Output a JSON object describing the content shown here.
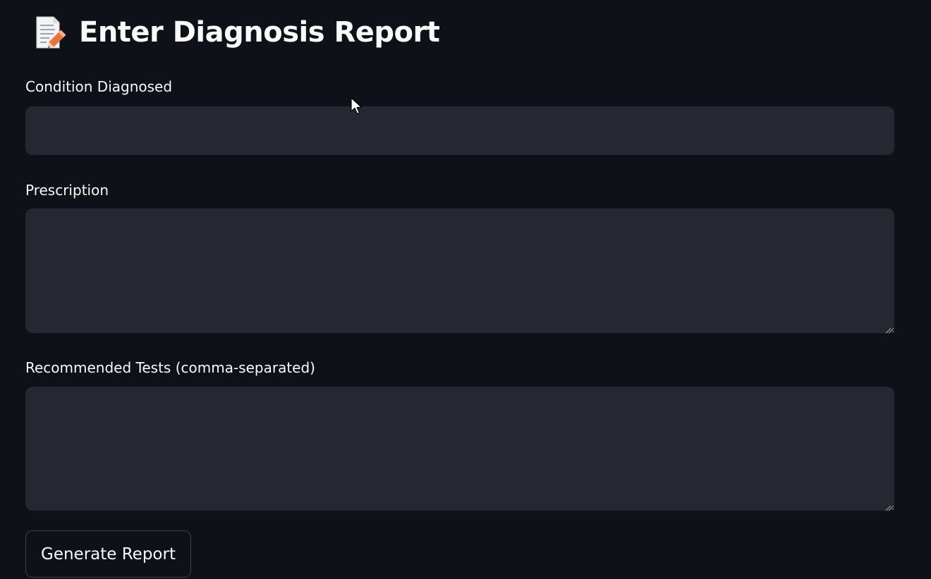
{
  "header": {
    "icon": "memo-icon",
    "title": "Enter Diagnosis Report"
  },
  "form": {
    "condition": {
      "label": "Condition Diagnosed",
      "value": "",
      "placeholder": ""
    },
    "prescription": {
      "label": "Prescription",
      "value": "",
      "placeholder": ""
    },
    "tests": {
      "label": "Recommended Tests (comma-separated)",
      "value": "",
      "placeholder": ""
    },
    "submit_label": "Generate Report"
  },
  "colors": {
    "background": "#0e1117",
    "input_background": "#262730",
    "text": "#fafafa",
    "button_border": "#3d4050"
  }
}
